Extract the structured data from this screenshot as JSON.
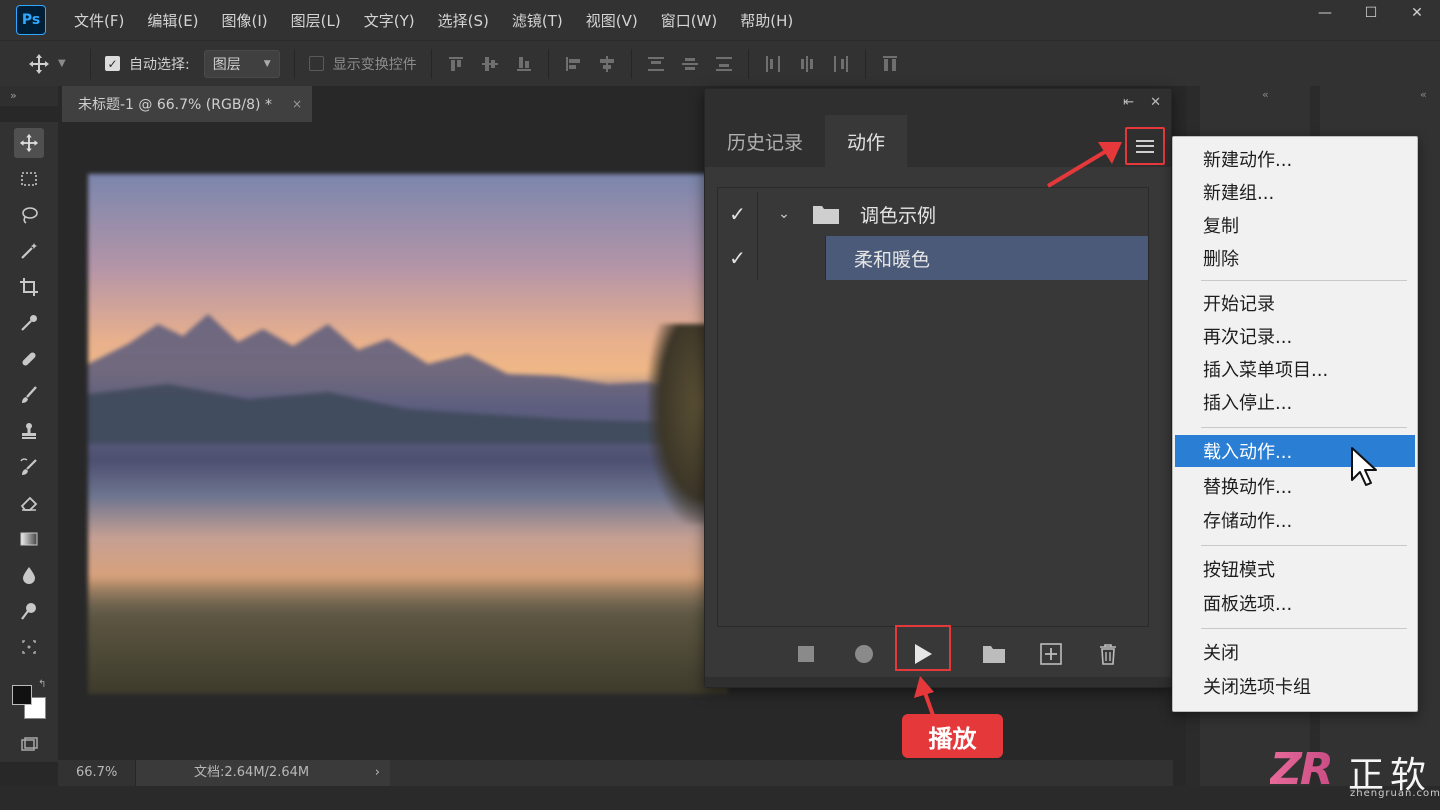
{
  "app": {
    "logo": "Ps"
  },
  "menubar": {
    "items": [
      "文件(F)",
      "编辑(E)",
      "图像(I)",
      "图层(L)",
      "文字(Y)",
      "选择(S)",
      "滤镜(T)",
      "视图(V)",
      "窗口(W)",
      "帮助(H)"
    ]
  },
  "window_controls": {
    "minimize": "—",
    "maximize": "☐",
    "close": "✕"
  },
  "options": {
    "auto_select_label": "自动选择:",
    "auto_select_checked": true,
    "auto_select_value": "图层",
    "show_transform_label": "显示变换控件",
    "show_transform_checked": false
  },
  "document": {
    "tab_title": "未标题-1 @ 66.7% (RGB/8) *",
    "tab_close": "×",
    "zoom": "66.7%",
    "doc_info": "文档:2.64M/2.64M"
  },
  "panel": {
    "tabs": [
      "历史记录",
      "动作"
    ],
    "active_tab": "动作",
    "actions": [
      {
        "name": "调色示例",
        "type": "set",
        "checked": true,
        "expanded": true
      },
      {
        "name": "柔和暖色",
        "type": "action",
        "checked": true,
        "selected": true
      }
    ],
    "bottom_icons": [
      "stop-icon",
      "record-icon",
      "play-icon",
      "new-set-icon",
      "new-action-icon",
      "trash-icon"
    ]
  },
  "flyout_menu": {
    "groups": [
      [
        "新建动作...",
        "新建组...",
        "复制",
        "删除"
      ],
      [
        "开始记录",
        "再次记录...",
        "插入菜单项目...",
        "插入停止..."
      ],
      [
        "载入动作...",
        "替换动作...",
        "存储动作..."
      ],
      [
        "按钮模式",
        "面板选项..."
      ],
      [
        "关闭",
        "关闭选项卡组"
      ]
    ],
    "highlighted": "载入动作..."
  },
  "annotation": {
    "play_label": "播放"
  },
  "watermark": {
    "logo": "ZR",
    "text": "正软",
    "url": "zhengruan.com"
  },
  "colors": {
    "accent_red": "#e5383b",
    "highlight_blue": "#2a7fd4",
    "selected_row": "#4a5a78"
  }
}
